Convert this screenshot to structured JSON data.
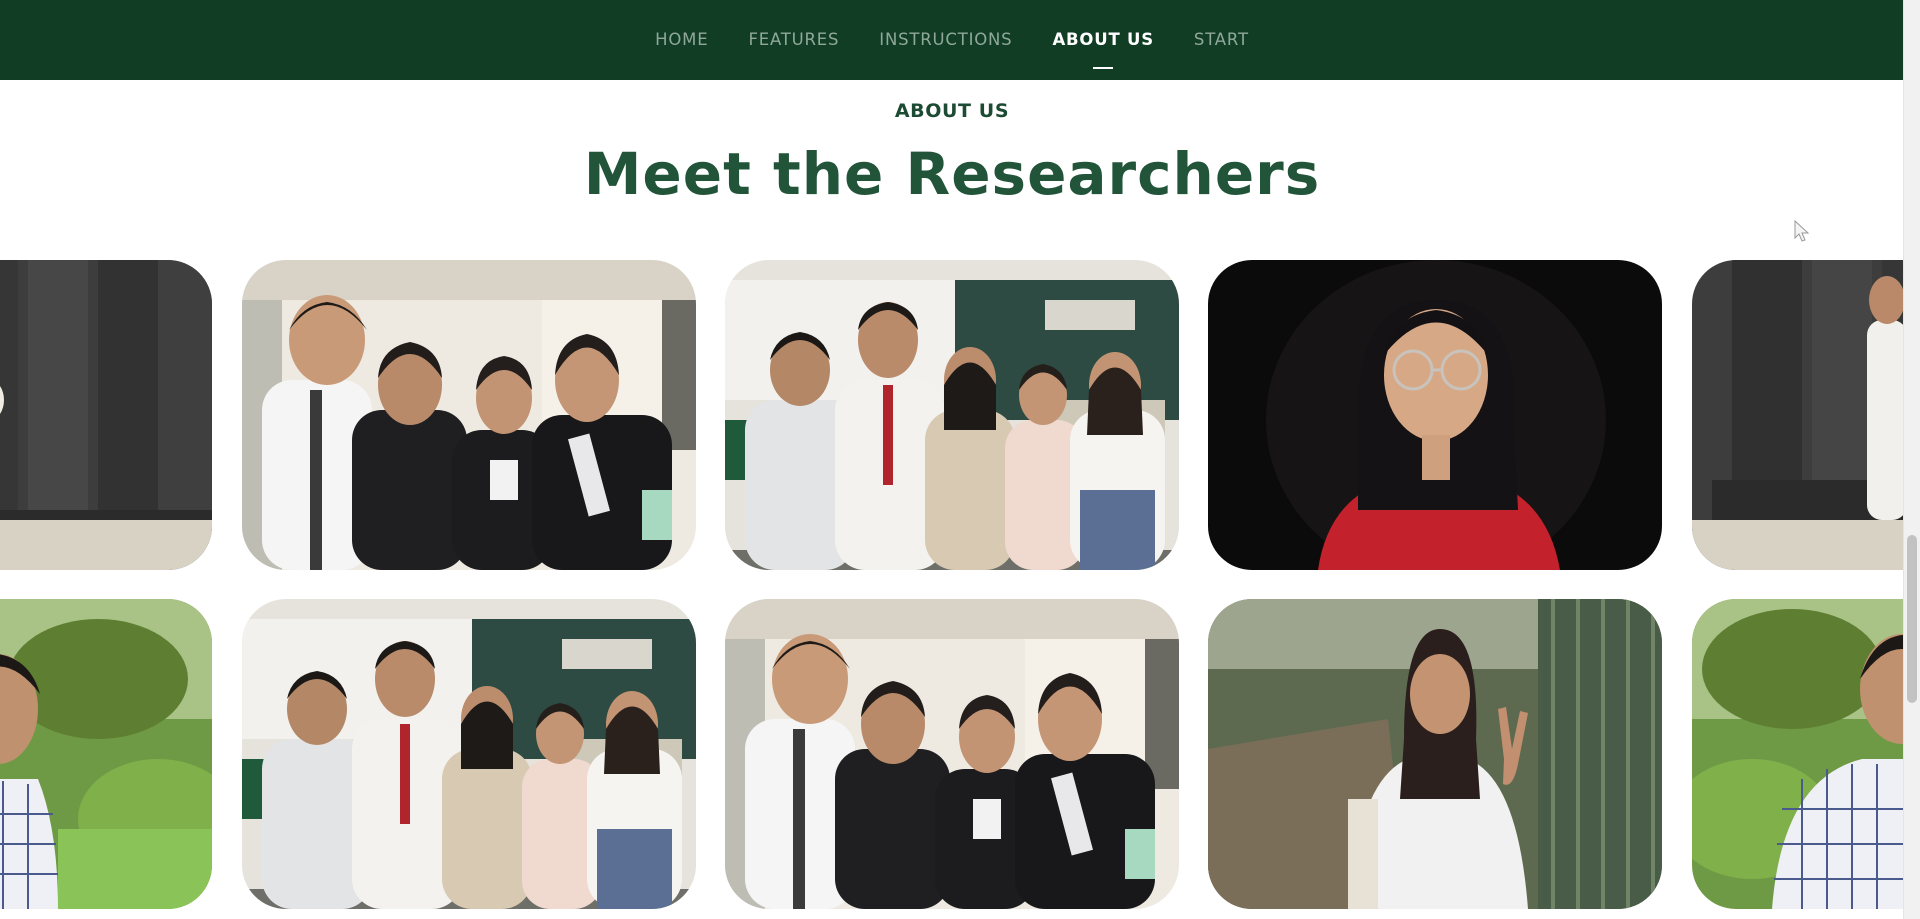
{
  "nav": {
    "items": [
      {
        "label": "HOME",
        "active": false
      },
      {
        "label": "FEATURES",
        "active": false
      },
      {
        "label": "INSTRUCTIONS",
        "active": false
      },
      {
        "label": "ABOUT US",
        "active": true
      },
      {
        "label": "START",
        "active": false
      }
    ]
  },
  "section": {
    "eyebrow": "ABOUT US",
    "title": "Meet the Researchers"
  },
  "gallery": {
    "row1": [
      {
        "photo": "solo-portrait-dark-wall"
      },
      {
        "photo": "group-four-formal-classroom"
      },
      {
        "photo": "group-five-classroom-board"
      },
      {
        "photo": "solo-portrait-red-shirt-glasses"
      },
      {
        "photo": "solo-portrait-dark-wall"
      }
    ],
    "row2": [
      {
        "photo": "solo-portrait-plaid-shirt-garden"
      },
      {
        "photo": "group-five-classroom-board"
      },
      {
        "photo": "group-four-formal-classroom"
      },
      {
        "photo": "solo-portrait-peace-sign-path"
      },
      {
        "photo": "solo-portrait-plaid-shirt-garden"
      }
    ]
  },
  "colors": {
    "nav_bg": "#113d24",
    "nav_text": "#8fa89a",
    "nav_active": "#ffffff",
    "heading": "#22543a"
  }
}
